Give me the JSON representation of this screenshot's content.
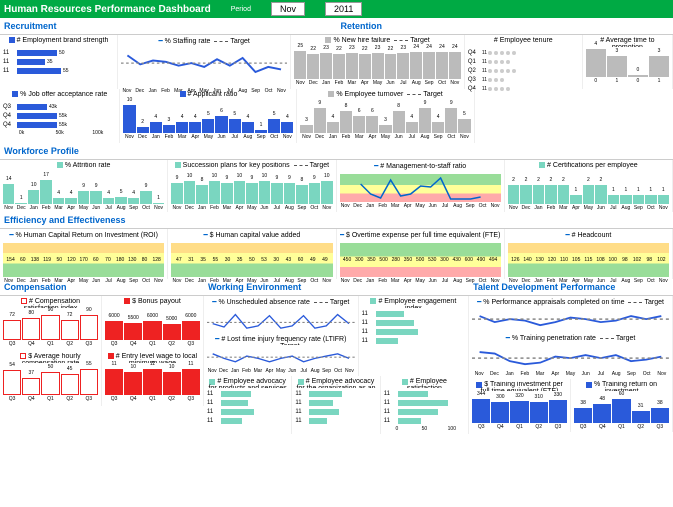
{
  "header": {
    "title": "Human Resources Performance Dashboard",
    "period_label": "Period",
    "month": "Nov",
    "year": "2011"
  },
  "months": [
    "Nov 2010",
    "Dec",
    "Jan",
    "Feb",
    "Mar",
    "Apr",
    "May",
    "Jun",
    "Jul",
    "Aug",
    "Sep",
    "Oct",
    "Nov 2011"
  ],
  "sections": {
    "recruitment": "Recruitment",
    "retention": "Retention",
    "workforce": "Workforce Profile",
    "efficiency": "Efficiency and Effectiveness",
    "compensation": "Compensation",
    "working_env": "Working Environment",
    "talent": "Talent Development Performance"
  },
  "chart_data": [
    {
      "id": "brand_strength",
      "title": "# Employment brand strength",
      "type": "bar-h",
      "categories": [
        "11",
        "11",
        "11"
      ],
      "values": [
        50,
        35,
        55
      ],
      "xmax": 100
    },
    {
      "id": "staffing_rate",
      "title": "% Staffing rate",
      "type": "line",
      "series": [
        {
          "name": "% Staffing rate",
          "values": [
            99,
            83,
            89,
            86,
            81,
            84,
            80,
            90,
            81,
            92,
            72,
            80,
            75
          ]
        }
      ],
      "target": 85
    },
    {
      "id": "new_hire_failure",
      "title": "% New hire failure",
      "type": "bar",
      "values": [
        25,
        22,
        23,
        22,
        23,
        22,
        23,
        22,
        23,
        24,
        24,
        24,
        24
      ],
      "target": 23,
      "ylim": [
        0,
        25
      ]
    },
    {
      "id": "employee_tenure",
      "title": "# Employee tenure",
      "type": "dot",
      "categories": [
        "Q4",
        "Q1",
        "Q2",
        "Q3",
        "Q4"
      ],
      "values": [
        11,
        11,
        11,
        11,
        11
      ]
    },
    {
      "id": "time_to_promotion",
      "title": "# Average time to promotion",
      "type": "bar-sparse",
      "values": [
        4,
        3,
        0,
        3
      ],
      "ylim": [
        0,
        4
      ]
    },
    {
      "id": "offer_acceptance",
      "title": "% Job offer acceptance rate",
      "type": "bar-h",
      "categories": [
        "Q3",
        "Q4",
        "Q4"
      ],
      "values": [
        43,
        55,
        55
      ],
      "labels": [
        "43k",
        "55k",
        "55k"
      ],
      "xmax": 100
    },
    {
      "id": "applicant_ratio",
      "title": "# Applicant ratio",
      "type": "bar",
      "values": [
        10,
        2,
        4,
        3,
        4,
        4,
        5,
        6,
        5,
        4,
        1,
        5,
        4
      ],
      "ylim": [
        0,
        10
      ],
      "color": "blue"
    },
    {
      "id": "employee_turnover",
      "title": "% Employee turnover",
      "type": "bar",
      "values": [
        3,
        9,
        4,
        8,
        6,
        6,
        3,
        8,
        4,
        9,
        4,
        9,
        5
      ],
      "target": 6,
      "color": "gray",
      "ylim": [
        0,
        10
      ]
    },
    {
      "id": "attrition_rate",
      "title": "% Attrition rate",
      "type": "bar",
      "values": [
        14,
        1,
        10,
        17,
        4,
        4,
        9,
        9,
        4,
        5,
        4,
        9,
        1
      ],
      "ylim": [
        0,
        20
      ],
      "color": "teal"
    },
    {
      "id": "succession_plans",
      "title": "Succession plans for key positions",
      "type": "bar",
      "values": [
        9,
        10,
        8,
        10,
        9,
        10,
        9,
        10,
        9,
        9,
        8,
        9,
        10
      ],
      "target": 9,
      "color": "teal"
    },
    {
      "id": "mgmt_staff_ratio",
      "title": "# Management-to-staff ratio",
      "type": "line-banded",
      "values": [
        0.19,
        0.09,
        0.05,
        0.22,
        0.07,
        0.09,
        0.14,
        0.13,
        0.24,
        0.04,
        0.04,
        0.04,
        0.06
      ]
    },
    {
      "id": "certifications",
      "title": "# Certifications per employee",
      "type": "bar",
      "values": [
        2,
        2,
        2,
        2,
        2,
        1,
        2,
        2,
        1,
        1,
        1,
        1,
        1
      ],
      "target": 2,
      "color": "teal"
    },
    {
      "id": "hc_roi",
      "title": "% Human Capital Return on Investment (ROI)",
      "type": "banded",
      "values": [
        154,
        60,
        138,
        119,
        50,
        120,
        170,
        60,
        70,
        180,
        130,
        80,
        128
      ]
    },
    {
      "id": "hc_value_added",
      "title": "$ Human capital value added",
      "type": "banded",
      "values": [
        47,
        31,
        35,
        55,
        30,
        35,
        50,
        53,
        30,
        43,
        60,
        49,
        49
      ]
    },
    {
      "id": "overtime_expense",
      "title": "$ Overtime expense per full time equivalent (FTE)",
      "type": "banded-rev",
      "values": [
        450,
        300,
        350,
        500,
        280,
        350,
        500,
        530,
        300,
        430,
        600,
        490,
        494
      ]
    },
    {
      "id": "headcount",
      "title": "# Headcount",
      "type": "banded",
      "values": [
        126,
        140,
        130,
        120,
        110,
        105,
        115,
        108,
        100,
        98,
        102,
        98,
        102
      ]
    },
    {
      "id": "comp_satisfaction",
      "title": "# Compensation satisfaction index",
      "type": "bar",
      "values": [
        72,
        80,
        90,
        72,
        90
      ],
      "categories": [
        "Q3",
        "Q4",
        "Q1",
        "Q2",
        "Q3"
      ],
      "ylim": [
        0,
        100
      ],
      "color": "red-outline"
    },
    {
      "id": "bonus_payout",
      "title": "$ Bonus payout",
      "type": "bar",
      "values": [
        6000,
        5500,
        6000,
        5000,
        6000
      ],
      "categories": [
        "Q3",
        "Q4",
        "Q1",
        "Q2",
        "Q3"
      ],
      "ylim": [
        0,
        9000
      ],
      "color": "red"
    },
    {
      "id": "hourly_comp",
      "title": "$ Average hourly compensation rate",
      "type": "bar",
      "values": [
        54,
        37,
        50,
        45,
        55
      ],
      "categories": [
        "Q3",
        "Q4",
        "Q1",
        "Q2",
        "Q3"
      ],
      "color": "red-outline"
    },
    {
      "id": "entry_wage",
      "title": "# Entry level wage to local minimum wage",
      "type": "bar",
      "values": [
        11,
        10,
        11,
        10,
        11
      ],
      "categories": [
        "Q3",
        "Q4",
        "Q1",
        "Q2",
        "Q3"
      ],
      "color": "red"
    },
    {
      "id": "absence_rate",
      "title": "% Unscheduled absence rate",
      "type": "line",
      "values": [
        9,
        7,
        16,
        6,
        8,
        15,
        6,
        8,
        15,
        6,
        8,
        16,
        9
      ],
      "target": 10
    },
    {
      "id": "ltifr",
      "title": "# Lost time injury frequency rate (LTIFR)",
      "type": "line",
      "values": [
        6,
        4,
        3,
        5,
        4,
        3,
        4,
        5,
        3,
        4,
        5,
        6,
        4
      ],
      "target": 5
    },
    {
      "id": "engagement",
      "title": "# Employee engagement index",
      "type": "bar-h",
      "categories": [
        "11",
        "11",
        "11",
        "11"
      ],
      "values": [
        40,
        55,
        60,
        30
      ]
    },
    {
      "id": "advocacy_products",
      "title": "# Employee advocacy for products and services",
      "type": "bar-h",
      "categories": [
        "11",
        "11",
        "11",
        "11"
      ],
      "values": [
        50,
        45,
        55,
        35
      ]
    },
    {
      "id": "advocacy_employer",
      "title": "# Employee advocacy for the organization as an employer",
      "type": "bar-h",
      "categories": [
        "11",
        "11",
        "11",
        "11"
      ],
      "values": [
        55,
        40,
        50,
        30
      ]
    },
    {
      "id": "satisfaction",
      "title": "# Employee satisfaction",
      "type": "bar-h",
      "categories": [
        "11",
        "11",
        "11",
        "11"
      ],
      "values": [
        60,
        100,
        80,
        45
      ]
    },
    {
      "id": "appraisals",
      "title": "% Performance appraisals completed on time",
      "type": "line",
      "values": [
        78,
        70,
        75,
        72,
        68,
        70,
        76,
        75,
        70,
        72,
        78,
        75,
        78
      ],
      "target": 75
    },
    {
      "id": "training_penetration",
      "title": "% Training penetration rate",
      "type": "line",
      "values": [
        85,
        84,
        74,
        70,
        72,
        78,
        76,
        80,
        77,
        80,
        74,
        75,
        79
      ],
      "target": 78
    },
    {
      "id": "training_investment",
      "title": "$ Training investment per full time equivalent (FTE)",
      "type": "bar",
      "values": [
        344,
        300,
        320,
        310,
        330
      ],
      "categories": [
        "Q3",
        "Q4",
        "Q1",
        "Q2",
        "Q3"
      ],
      "color": "blue"
    },
    {
      "id": "training_roi",
      "title": "% Training return on investment",
      "type": "bar",
      "values": [
        38,
        48,
        60,
        31,
        38
      ],
      "categories": [
        "Q3",
        "Q4",
        "Q1",
        "Q2",
        "Q3"
      ],
      "color": "blue"
    }
  ]
}
